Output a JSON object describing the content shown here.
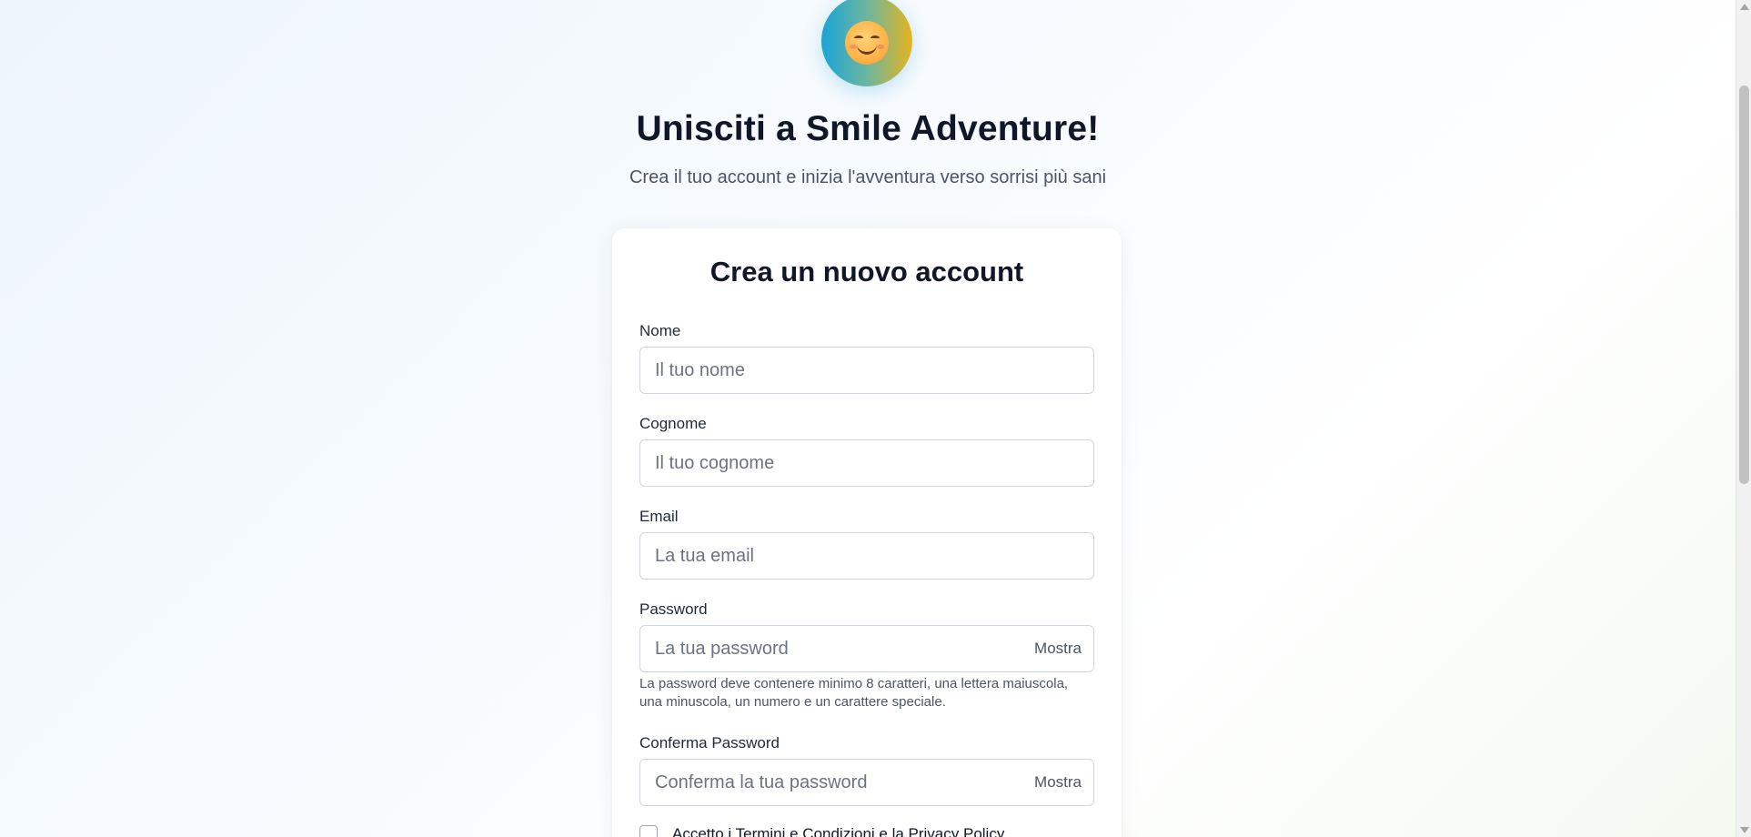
{
  "hero": {
    "logo_icon": "smiling-face-icon",
    "title": "Unisciti a Smile Adventure!",
    "subtitle": "Crea il tuo account e inizia l'avventura verso sorrisi più sani"
  },
  "form": {
    "title": "Crea un nuovo account",
    "nome": {
      "label": "Nome",
      "placeholder": "Il tuo nome",
      "value": ""
    },
    "cognome": {
      "label": "Cognome",
      "placeholder": "Il tuo cognome",
      "value": ""
    },
    "email": {
      "label": "Email",
      "placeholder": "La tua email",
      "value": ""
    },
    "password": {
      "label": "Password",
      "placeholder": "La tua password",
      "value": "",
      "toggle_label": "Mostra",
      "hint": "La password deve contenere minimo 8 caratteri, una lettera maiuscola, una minuscola, un numero e un carattere speciale."
    },
    "confirm_password": {
      "label": "Conferma Password",
      "placeholder": "Conferma la tua password",
      "value": "",
      "toggle_label": "Mostra"
    },
    "terms": {
      "label": "Accetto i Termini e Condizioni e la Privacy Policy",
      "checked": false
    }
  },
  "colors": {
    "heading": "#0f1729",
    "logo_gradient_start": "#1aa3d9",
    "logo_gradient_end": "#e6b41e"
  }
}
